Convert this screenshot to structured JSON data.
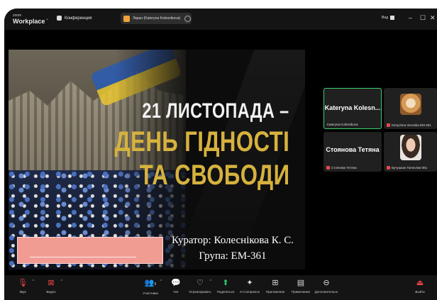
{
  "titlebar": {
    "logo_top": "zoom",
    "logo_bottom": "Workplace",
    "chevron": "⌄",
    "conference": "Конференция",
    "share_pill": "Экран (Kateryna Kolesnikova)",
    "view": "Вид",
    "minimize": "–",
    "maximize": "☐",
    "close": "✕"
  },
  "slide": {
    "line1": "21 ЛИСТОПАДА –",
    "line2": "ДЕНЬ ГІДНОСТІ",
    "line3": "ТА СВОБОДИ",
    "curator": "Куратор: Колеснікова К. С.",
    "group": "Група: ЕМ-361"
  },
  "participants": [
    {
      "big": "Kateryna  Kolesn...",
      "label": "Kateryna Kolesnikova",
      "muted": false
    },
    {
      "big": "",
      "label": "Kirnychna Veronika ЕМ-361",
      "muted": true
    },
    {
      "big": "Стоянова Тетяна",
      "label": "Стоянова Тетяна",
      "muted": true
    },
    {
      "big": "",
      "label": "Бучушкан Ганна Бм-361",
      "muted": true
    }
  ],
  "toolbar": {
    "audio": "Звук",
    "video": "Видео",
    "participants": "Участники",
    "participants_count": "5",
    "chat": "Чат",
    "react": "Отреагировать",
    "share": "Поделиться",
    "ai": "AI Companion",
    "apps": "Приложения",
    "notes": "Примечания",
    "more": "Дополнительно",
    "leave": "Выйти"
  },
  "colors": {
    "accent_gold": "#d6b23e",
    "active_border": "#3bd06f",
    "share_green": "#2fc56a",
    "muted_red": "#ea4545",
    "redaction": "#f19c93"
  }
}
